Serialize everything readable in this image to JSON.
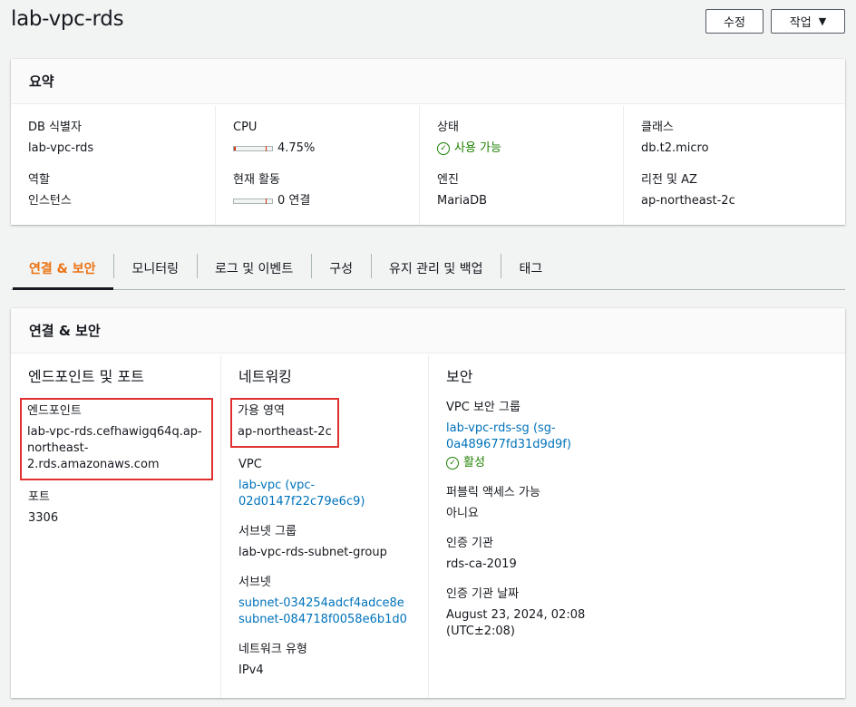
{
  "page": {
    "title": "lab-vpc-rds",
    "edit_label": "수정",
    "actions_label": "작업"
  },
  "summary": {
    "title": "요약",
    "db_id_label": "DB 식별자",
    "db_id": "lab-vpc-rds",
    "role_label": "역할",
    "role": "인스턴스",
    "cpu_label": "CPU",
    "cpu": "4.75%",
    "cpu_fraction": 0.0475,
    "activity_label": "현재 활동",
    "activity": "0 연결",
    "status_label": "상태",
    "status": "사용 가능",
    "engine_label": "엔진",
    "engine": "MariaDB",
    "class_label": "클래스",
    "class": "db.t2.micro",
    "region_label": "리전 및 AZ",
    "region": "ap-northeast-2c"
  },
  "tabs": [
    {
      "label": "연결 & 보안",
      "active": true
    },
    {
      "label": "모니터링"
    },
    {
      "label": "로그 및 이벤트"
    },
    {
      "label": "구성"
    },
    {
      "label": "유지 관리 및 백업"
    },
    {
      "label": "태그"
    }
  ],
  "connectivity": {
    "title": "연결 & 보안",
    "endpoint_section": "엔드포인트 및 포트",
    "endpoint_label": "엔드포인트",
    "endpoint_line1": "lab-vpc-rds.cefhawigq64q.ap-",
    "endpoint_line2": "northeast-2.rds.amazonaws.com",
    "port_label": "포트",
    "port": "3306",
    "network_section": "네트워킹",
    "az_label": "가용 영역",
    "az": "ap-northeast-2c",
    "vpc_label": "VPC",
    "vpc_line1": "lab-vpc (vpc-",
    "vpc_line2": "02d0147f22c79e6c9)",
    "subnet_group_label": "서브넷 그룹",
    "subnet_group": "lab-vpc-rds-subnet-group",
    "subnets_label": "서브넷",
    "subnet1": "subnet-034254adcf4adce8e",
    "subnet2": "subnet-084718f0058e6b1d0",
    "network_type_label": "네트워크 유형",
    "network_type": "IPv4",
    "security_section": "보안",
    "sg_label": "VPC 보안 그룹",
    "sg_line1": "lab-vpc-rds-sg (sg-",
    "sg_line2": "0a489677fd31d9d9f)",
    "sg_status": "활성",
    "public_label": "퍼블릭 액세스 가능",
    "public": "아니요",
    "ca_label": "인증 기관",
    "ca": "rds-ca-2019",
    "ca_date_label": "인증 기관 날짜",
    "ca_date_line1": "August 23, 2024, 02:08",
    "ca_date_line2": "(UTC±2:08)"
  },
  "colors": {
    "accent": "#ec7211",
    "link": "#0073bb",
    "success": "#1d8102",
    "highlight": "#e0302f"
  }
}
